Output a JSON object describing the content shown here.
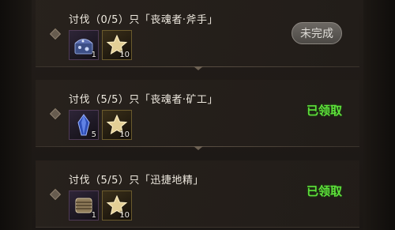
{
  "quests": [
    {
      "title": "讨伐（0/5）只「丧魂者·斧手」",
      "status": "未完成",
      "status_type": "pending",
      "rewards": [
        {
          "icon": "ore-chest-icon",
          "count": "1"
        },
        {
          "icon": "star-currency-icon",
          "count": "10"
        }
      ]
    },
    {
      "title": "讨伐（5/5）只「丧魂者·矿工」",
      "status": "已领取",
      "status_type": "done",
      "rewards": [
        {
          "icon": "blue-crystal-icon",
          "count": "5"
        },
        {
          "icon": "star-currency-icon",
          "count": "10"
        }
      ]
    },
    {
      "title": "讨伐（5/5）只「迅捷地精」",
      "status": "已领取",
      "status_type": "done",
      "rewards": [
        {
          "icon": "scroll-bundle-icon",
          "count": "1"
        },
        {
          "icon": "star-currency-icon",
          "count": "10"
        }
      ]
    }
  ],
  "colors": {
    "claimed_text": "#5de13a",
    "pending_button": "#5a5652"
  }
}
